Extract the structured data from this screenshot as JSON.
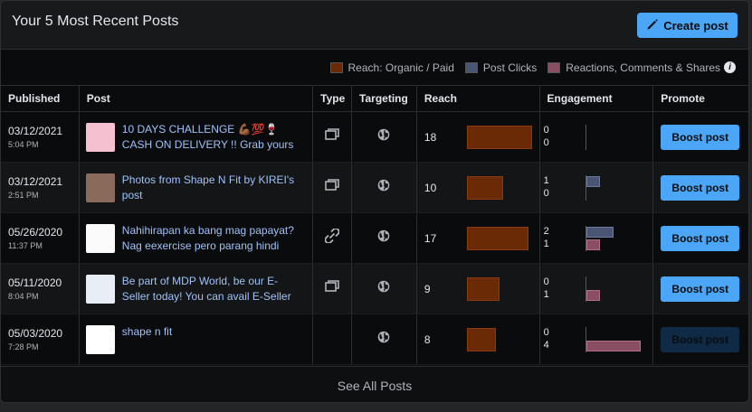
{
  "header": {
    "title": "Your 5 Most Recent Posts",
    "create_label": "Create post"
  },
  "legend": {
    "reach": "Reach: Organic / Paid",
    "clicks": "Post Clicks",
    "reactions": "Reactions, Comments & Shares",
    "info": "i",
    "colors": {
      "reach": "#6b2a06",
      "clicks": "#4a5573",
      "reactions": "#8a4e63"
    }
  },
  "columns": [
    "Published",
    "Post",
    "Type",
    "Targeting",
    "Reach",
    "Engagement",
    "Promote"
  ],
  "rows": [
    {
      "date": "03/12/2021",
      "time": "5:04 PM",
      "text": "10 DAYS CHALLENGE 💪🏾💯🍷 CASH ON DELIVERY !! Grab yours",
      "type": "album",
      "reach": "18",
      "reach_value": 18,
      "clicks": "0",
      "clicks_value": 0,
      "reactions": "0",
      "reactions_value": 0,
      "boost": "Boost post",
      "boost_enabled": true,
      "thumb": "#f5c0cf"
    },
    {
      "date": "03/12/2021",
      "time": "2:51 PM",
      "text": "Photos from Shape N Fit by KIREI's post",
      "type": "album",
      "reach": "10",
      "reach_value": 10,
      "clicks": "1",
      "clicks_value": 1,
      "reactions": "0",
      "reactions_value": 0,
      "boost": "Boost post",
      "boost_enabled": true,
      "thumb": "#8a6a5a"
    },
    {
      "date": "05/26/2020",
      "time": "11:37 PM",
      "text": "Nahihirapan ka bang mag papayat? Nag eexercise pero parang hindi",
      "type": "link",
      "reach": "17",
      "reach_value": 17,
      "clicks": "2",
      "clicks_value": 2,
      "reactions": "1",
      "reactions_value": 1,
      "boost": "Boost post",
      "boost_enabled": true,
      "thumb": "#fbfbfb"
    },
    {
      "date": "05/11/2020",
      "time": "8:04 PM",
      "text": "Be part of MDP World, be our E-Seller today! You can avail E-Seller",
      "type": "album",
      "reach": "9",
      "reach_value": 9,
      "clicks": "0",
      "clicks_value": 0,
      "reactions": "1",
      "reactions_value": 1,
      "boost": "Boost post",
      "boost_enabled": true,
      "thumb": "#e8eef5"
    },
    {
      "date": "05/03/2020",
      "time": "7:28 PM",
      "text": "shape n fit",
      "type": "",
      "reach": "8",
      "reach_value": 8,
      "clicks": "0",
      "clicks_value": 0,
      "reactions": "4",
      "reactions_value": 4,
      "boost": "Boost post",
      "boost_enabled": false,
      "thumb": "#ffffff"
    }
  ],
  "footer": {
    "see_all": "See All Posts"
  }
}
